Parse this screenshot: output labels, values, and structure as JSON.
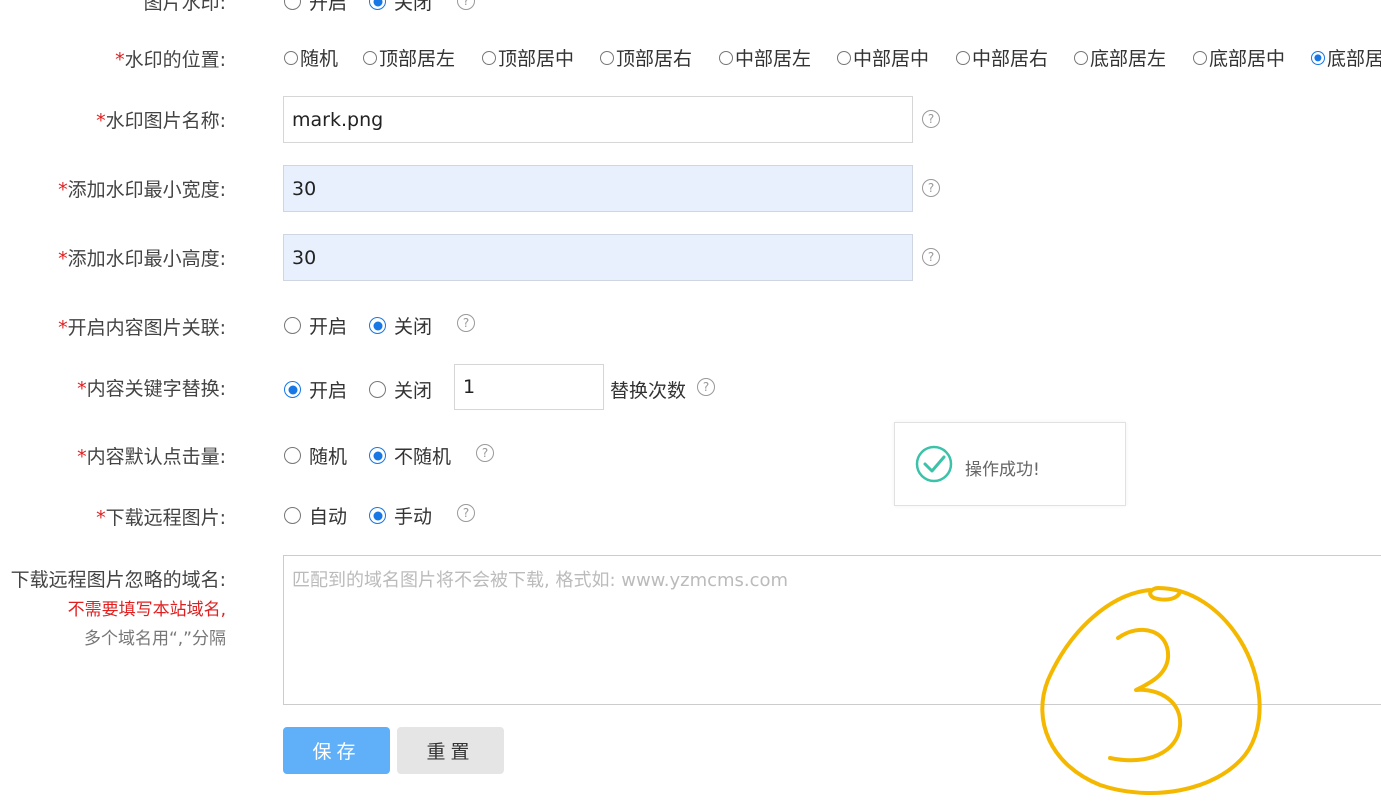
{
  "rows": {
    "image_watermark": {
      "label": "图片水印:",
      "opt1": "开启",
      "opt2": "关闭"
    },
    "watermark_position": {
      "req": "*",
      "label": "水印的位置:",
      "options": [
        "随机",
        "顶部居左",
        "顶部居中",
        "顶部居右",
        "中部居左",
        "中部居中",
        "中部居右",
        "底部居左",
        "底部居中",
        "底部居"
      ],
      "selected_index": 9
    },
    "watermark_image_name": {
      "req": "*",
      "label": "水印图片名称:",
      "value": "mark.png"
    },
    "watermark_min_width": {
      "req": "*",
      "label": "添加水印最小宽度:",
      "value": "30"
    },
    "watermark_min_height": {
      "req": "*",
      "label": "添加水印最小高度:",
      "value": "30"
    },
    "content_image_link": {
      "req": "*",
      "label": "开启内容图片关联:",
      "opt1": "开启",
      "opt2": "关闭",
      "selected": "关闭"
    },
    "keyword_replace": {
      "req": "*",
      "label": "内容关键字替换:",
      "opt1": "开启",
      "opt2": "关闭",
      "selected": "开启",
      "count_value": "1",
      "count_label": "替换次数"
    },
    "default_clicks": {
      "req": "*",
      "label": "内容默认点击量:",
      "opt1": "随机",
      "opt2": "不随机",
      "selected": "不随机"
    },
    "download_remote": {
      "req": "*",
      "label": "下载远程图片:",
      "opt1": "自动",
      "opt2": "手动",
      "selected": "手动"
    },
    "ignore_domains": {
      "label": "下载远程图片忽略的域名:",
      "note_red": "不需要填写本站域名,",
      "note_gray": "多个域名用“,”分隔",
      "placeholder": "匹配到的域名图片将不会被下载, 格式如: www.yzmcms.com"
    }
  },
  "toast": {
    "message": "操作成功!"
  },
  "buttons": {
    "save": "保存",
    "reset": "重置"
  },
  "help_icon": "question-circle-icon",
  "colors": {
    "accent": "#1677e5",
    "required": "#e02020",
    "save_btn": "#5fb0f8",
    "annotation": "#f5b800"
  }
}
